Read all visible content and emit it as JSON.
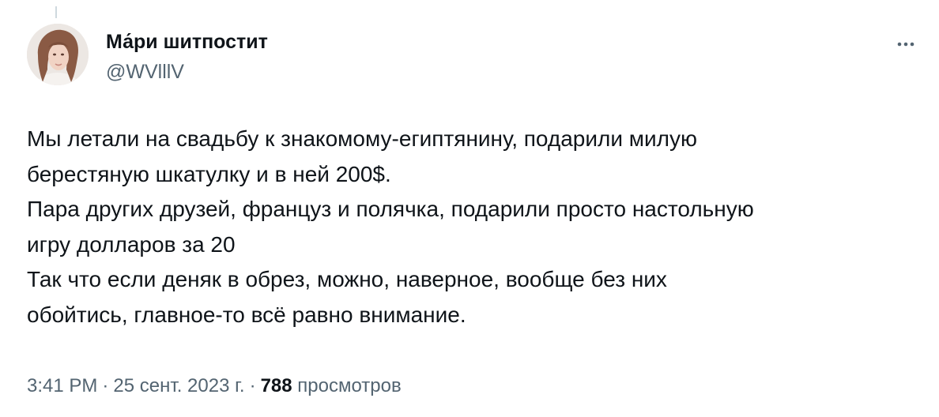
{
  "tweet": {
    "author": {
      "display_name": "Ма́ри шитпостит",
      "handle": "@WVlllV"
    },
    "text_paragraphs": [
      "Мы летали на свадьбу к знакомому-египтянину, подарили милую\nберестяную шкатулку и в ней 200$.",
      "Пара других друзей, француз и полячка, подарили просто настольную\nигру долларов за 20",
      "Так что если деняк в обрез, можно, наверное, вообще без них\nобойтись, главное-то всё равно внимание."
    ],
    "time": "3:41 PM",
    "date": "25 сент. 2023 г.",
    "views_count": "788",
    "views_label": "просмотров",
    "separator": "·"
  },
  "icons": {
    "more": "more-horizontal-icon",
    "avatar": "user-avatar"
  },
  "colors": {
    "text_primary": "#0f1419",
    "text_secondary": "#536471",
    "thread_line": "#cfd9de"
  }
}
